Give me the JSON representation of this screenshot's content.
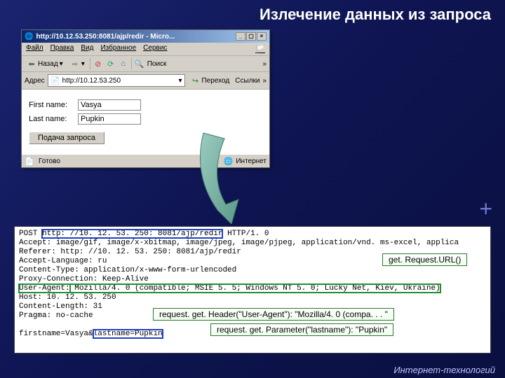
{
  "slide": {
    "title": "Излечение данных из запроса",
    "footer": "Интернет-технологий"
  },
  "browser": {
    "title": "http://10.12.53.250:8081/ajp/redir  -  Micro...",
    "menu": [
      "Файл",
      "Правка",
      "Вид",
      "Избранное",
      "Сервис"
    ],
    "back": "Назад",
    "addr_label": "Адрес",
    "addr_value": "http://10.12.53.250",
    "go": "Переход",
    "links": "Ссылки",
    "form": {
      "first_label": "First name:",
      "first_value": "Vasya",
      "last_label": "Last name:",
      "last_value": "Pupkin",
      "submit": "Подача запроса"
    },
    "status_left": "Готово",
    "status_right": "Интернет"
  },
  "raw": {
    "l1a": "POST ",
    "l1b": "http: //10. 12. 53. 250: 8081/ajp/redir",
    "l1c": " HTTP/1. 0",
    "l2": "Accept: image/gif, image/x-xbitmap, image/jpeg, image/pjpeg, application/vnd. ms-excel, applica",
    "l3": "Referer: http: //10. 12. 53. 250: 8081/ajp/redir",
    "l4": "Accept-Language: ru",
    "l5": "Content-Type: application/x-www-form-urlencoded",
    "l6": "Proxy-Connection: Keep-Alive",
    "l7a": "User-Agent:",
    "l7b": " Mozilla/4. 0 (compatible; MSIE 5. 5; Windows NT 5. 0; Lucky Net, Kiev, Ukraine)",
    "l8": "Host: 10. 12. 53. 250",
    "l9": "Content-Length: 31",
    "l10": "Pragma: no-cache",
    "l11a": "firstname=Vasya&",
    "l11b": "lastname=Pupkin"
  },
  "callouts": {
    "c1": "get. Request.URL()",
    "c2": "request. get. Header(\"User-Agent\"): \"Mozilla/4. 0 (compa. . . \"",
    "c3": "request. get. Parameter(\"lastname\"): \"Pupkin\""
  }
}
